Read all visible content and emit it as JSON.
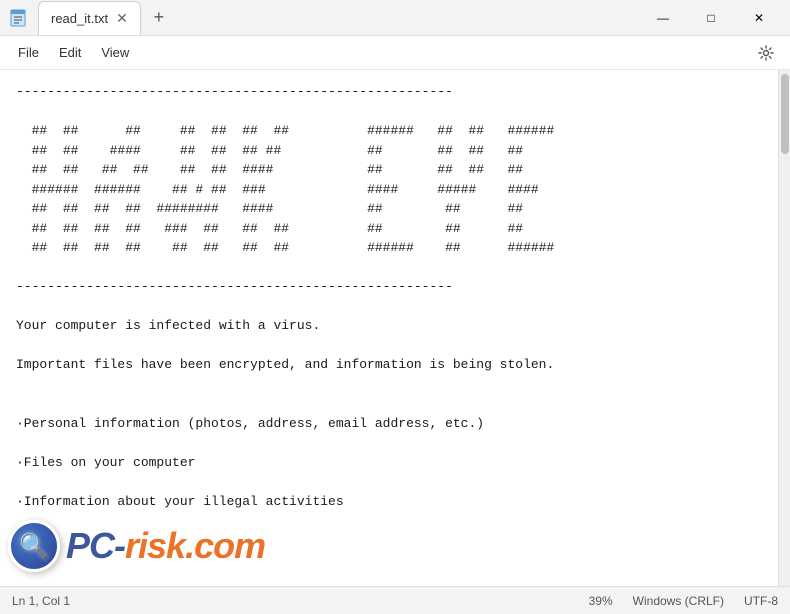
{
  "titlebar": {
    "icon": "notepad",
    "tab_label": "read_it.txt",
    "new_tab": "+",
    "minimize": "—",
    "maximize": "□",
    "close": "✕"
  },
  "menubar": {
    "items": [
      "File",
      "Edit",
      "View"
    ],
    "settings_icon": "gear"
  },
  "content": {
    "text": "--------------------------------------------------------\n\n  ##  ##      ##     ##  ##  ##  ##          ######   ##  ##   ######\n  ##  ##    ####     ##  ##  ## ##           ##       ##  ##   ##\n  ##  ##   ##  ##    ##  ##  ####            ##       ##  ##   ##\n  ######  ######    ## # ##  ###             ####     #####    ####\n  ##  ##  ##  ##  ########   ####            ##        ##      ##\n  ##  ##  ##  ##   ###  ##   ##  ##          ##        ##      ##\n  ##  ##  ##  ##    ##  ##   ##  ##          ######    ##      ######\n\n--------------------------------------------------------\n\nYour computer is infected with a virus.\n\nImportant files have been encrypted, and information is being stolen.\n\n\n·Personal information (photos, address, email address, etc.)\n\n·Files on your computer\n\n·Information about your illegal activities"
  },
  "statusbar": {
    "position": "Ln 1, Col 1",
    "zoom": "39%",
    "line_ending": "Windows (CRLF)",
    "encoding": "UTF-8"
  }
}
